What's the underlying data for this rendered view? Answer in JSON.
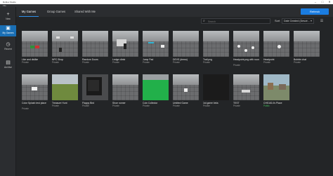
{
  "window": {
    "title": "Roblox Studio",
    "min": "–",
    "max": "□",
    "close": "✕"
  },
  "menu": {
    "label": "File"
  },
  "sidebar": {
    "items": [
      {
        "label": "New",
        "icon": "+"
      },
      {
        "label": "My Games",
        "icon": "▣"
      },
      {
        "label": "Recent",
        "icon": "◷"
      },
      {
        "label": "Archive",
        "icon": "▤"
      }
    ]
  },
  "tabs": [
    "My Games",
    "Group Games",
    "Shared With Me"
  ],
  "refresh_label": "Refresh",
  "search": {
    "placeholder": "Search",
    "icon": "⌕"
  },
  "sort": {
    "label": "Sort",
    "value": "Date Created (Descé...",
    "chevron": "▾"
  },
  "view_toggle_icon": "☰",
  "games": [
    {
      "name": "Like and dislike",
      "status": "Private"
    },
    {
      "name": "NPC Shop",
      "status": "Private"
    },
    {
      "name": "Random Doors",
      "status": "Private"
    },
    {
      "name": "Ledge climb",
      "status": "Private"
    },
    {
      "name": "Jump Pad",
      "status": "Private"
    },
    {
      "name": "DEVS (demo)",
      "status": "Private"
    },
    {
      "name": "Trail.png",
      "status": "Private"
    },
    {
      "name": "Headpoint.png with round system",
      "status": "Private"
    },
    {
      "name": "Headpoint",
      "status": "Private"
    },
    {
      "name": "Bubble chat",
      "status": "Private"
    },
    {
      "name": "Color Splash test place",
      "status": "Private"
    },
    {
      "name": "Treasure Hunt",
      "status": "Private"
    },
    {
      "name": "Flappy Bird",
      "status": "Private"
    },
    {
      "name": "Shoe runner",
      "status": "Private"
    },
    {
      "name": "Coin Collector",
      "status": "Private"
    },
    {
      "name": "Untitled Game",
      "status": "Private"
    },
    {
      "name": "1st game beta",
      "status": "Private"
    },
    {
      "name": "TEST",
      "status": "Private"
    },
    {
      "name": "CHS1614's Place",
      "status": "Public"
    }
  ]
}
